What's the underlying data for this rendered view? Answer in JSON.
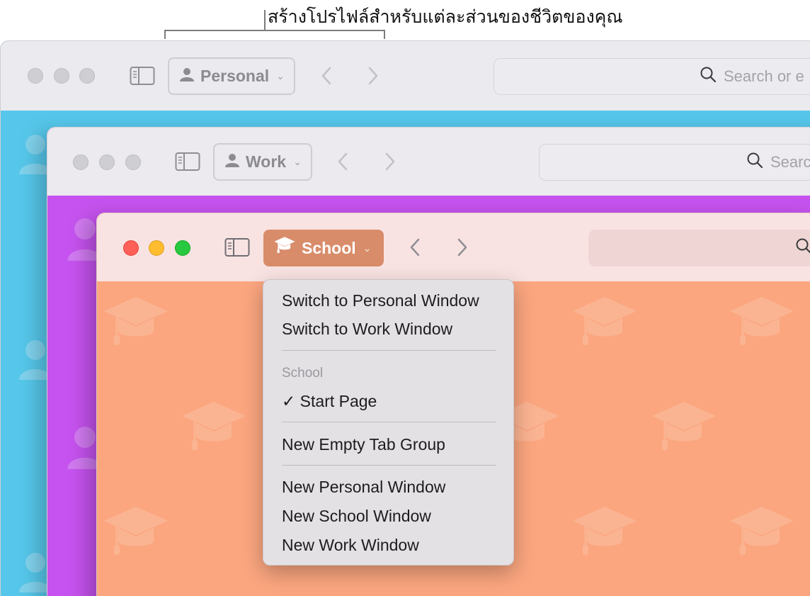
{
  "callout": {
    "text": "สร้างโปรไฟล์สำหรับแต่ละส่วนของชีวิตของคุณ"
  },
  "windows": {
    "personal": {
      "profile_label": "Personal",
      "search_placeholder": "Search or e",
      "background_color": "#56c7ea",
      "profile_icon": "person-icon"
    },
    "work": {
      "profile_label": "Work",
      "search_placeholder": "Searc",
      "background_color": "#c653ef",
      "profile_icon": "person-icon"
    },
    "school": {
      "profile_label": "School",
      "search_placeholder": "",
      "background_color": "#fba67f",
      "profile_color": "#d98c6a",
      "profile_icon": "graduation-cap-icon"
    }
  },
  "profile_menu": {
    "items": [
      {
        "label": "Switch to Personal Window"
      },
      {
        "label": "Switch to Work Window"
      }
    ],
    "section_header": "School",
    "checked_item": {
      "check": "✓",
      "label": "Start Page"
    },
    "new_tab_group": "New Empty Tab Group",
    "new_windows": [
      {
        "label": "New Personal Window"
      },
      {
        "label": "New School Window"
      },
      {
        "label": "New Work Window"
      }
    ]
  }
}
